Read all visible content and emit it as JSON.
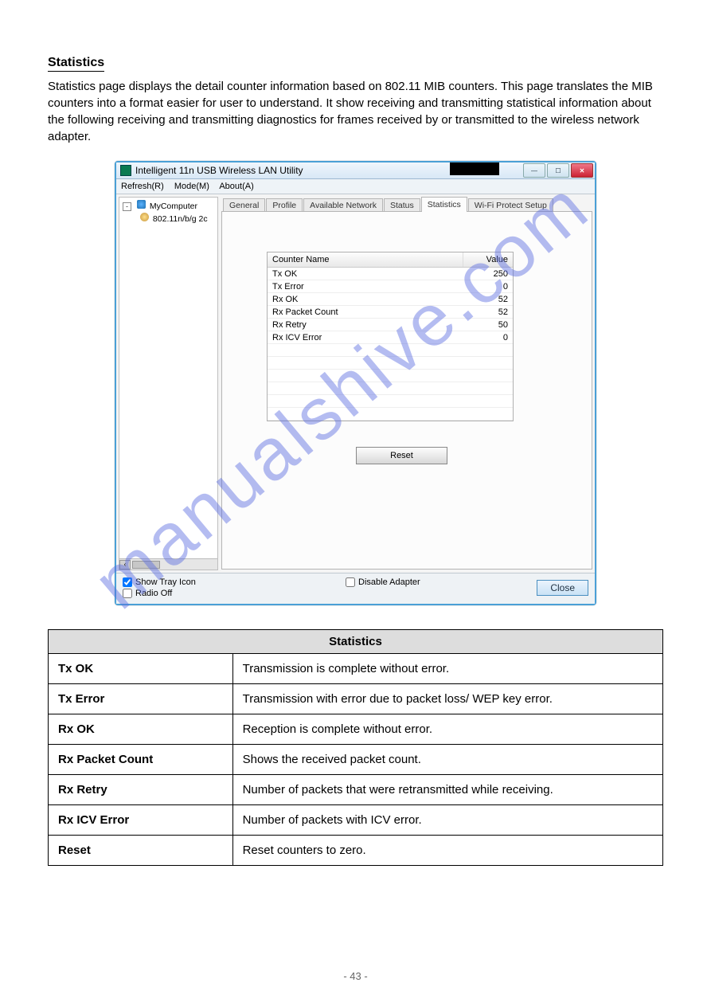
{
  "section": {
    "heading": "Statistics",
    "description": "Statistics page displays the detail counter information based on 802.11 MIB counters. This page translates the MIB counters into a format easier for user to understand. It show receiving and transmitting statistical information about the following receiving and transmitting diagnostics for frames received by or transmitted to the wireless network adapter."
  },
  "app": {
    "title": "Intelligent 11n USB Wireless LAN Utility",
    "menu": {
      "m0": "Refresh(R)",
      "m1": "Mode(M)",
      "m2": "About(A)"
    },
    "tree": {
      "root": "MyComputer",
      "child": "802.11n/b/g 2c"
    },
    "tabs": {
      "t0": "General",
      "t1": "Profile",
      "t2": "Available Network",
      "t3": "Status",
      "t4": "Statistics",
      "t5": "Wi-Fi Protect Setup"
    },
    "table_headers": {
      "c0": "Counter Name",
      "c1": "Value"
    },
    "counters": [
      {
        "name": "Tx OK",
        "value": "250"
      },
      {
        "name": "Tx Error",
        "value": "0"
      },
      {
        "name": "Rx OK",
        "value": "52"
      },
      {
        "name": "Rx Packet Count",
        "value": "52"
      },
      {
        "name": "Rx Retry",
        "value": "50"
      },
      {
        "name": "Rx ICV Error",
        "value": "0"
      }
    ],
    "buttons": {
      "reset": "Reset",
      "close": "Close"
    },
    "footer": {
      "show_tray": "Show Tray Icon",
      "radio_off": "Radio Off",
      "disable_adapter": "Disable Adapter"
    }
  },
  "table": {
    "header": "Statistics",
    "rows": [
      {
        "term": "Tx OK",
        "desc": "Transmission is complete without error."
      },
      {
        "term": "Tx Error",
        "desc": "Transmission with error due to packet loss/ WEP key error."
      },
      {
        "term": "Rx OK",
        "desc": "Reception is complete without error."
      },
      {
        "term": "Rx Packet Count",
        "desc": "Shows the received packet count."
      },
      {
        "term": "Rx Retry",
        "desc": "Number of packets that were retransmitted while receiving."
      },
      {
        "term": "Rx ICV Error",
        "desc": "Number of packets with ICV error."
      },
      {
        "term": "Reset",
        "desc": "Reset counters to zero."
      }
    ]
  },
  "page_number": "- 43 -",
  "watermark": "manualshive.com"
}
